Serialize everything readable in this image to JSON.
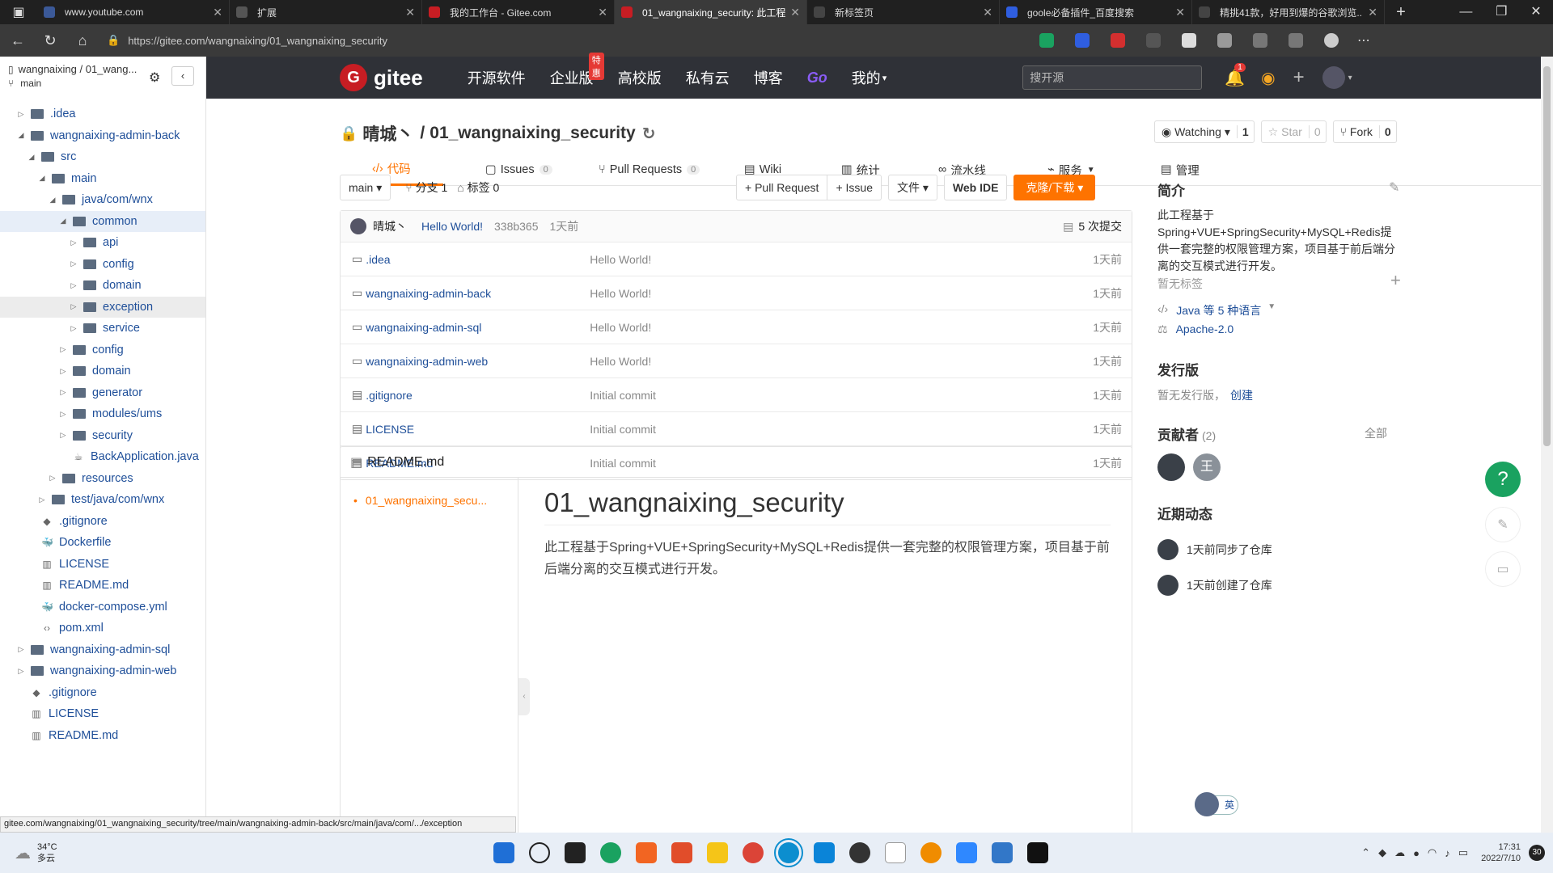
{
  "browser": {
    "tabs": [
      {
        "title": "www.youtube.com",
        "color": "#3b5998"
      },
      {
        "title": "扩展",
        "color": "#555"
      },
      {
        "title": "我的工作台 - Gitee.com",
        "color": "#c71d23"
      },
      {
        "title": "01_wangnaixing_security: 此工程...",
        "color": "#c71d23"
      },
      {
        "title": "新标签页",
        "color": "#444"
      },
      {
        "title": "goole必备插件_百度搜索",
        "color": "#2f5ee0"
      },
      {
        "title": "精挑41款，好用到爆的谷歌浏览...",
        "color": "#444"
      }
    ],
    "url": "https://gitee.com/wangnaixing/01_wangnaixing_security"
  },
  "sidebar": {
    "repo": "wangnaixing / 01_wang...",
    "branch": "main",
    "items": [
      {
        "label": ".idea",
        "type": "folder",
        "depth": 1,
        "open": false
      },
      {
        "label": "wangnaixing-admin-back",
        "type": "folder",
        "depth": 1,
        "open": true
      },
      {
        "label": "src",
        "type": "folder",
        "depth": 2,
        "open": true
      },
      {
        "label": "main",
        "type": "folder",
        "depth": 3,
        "open": true
      },
      {
        "label": "java/com/wnx",
        "type": "folder",
        "depth": 4,
        "open": true
      },
      {
        "label": "common",
        "type": "folder",
        "depth": 5,
        "open": true,
        "sel": true
      },
      {
        "label": "api",
        "type": "folder",
        "depth": 6,
        "open": false
      },
      {
        "label": "config",
        "type": "folder",
        "depth": 6,
        "open": false
      },
      {
        "label": "domain",
        "type": "folder",
        "depth": 6,
        "open": false
      },
      {
        "label": "exception",
        "type": "folder",
        "depth": 6,
        "open": false,
        "hov": true
      },
      {
        "label": "service",
        "type": "folder",
        "depth": 6,
        "open": false
      },
      {
        "label": "config",
        "type": "folder",
        "depth": 5,
        "open": false
      },
      {
        "label": "domain",
        "type": "folder",
        "depth": 5,
        "open": false
      },
      {
        "label": "generator",
        "type": "folder",
        "depth": 5,
        "open": false
      },
      {
        "label": "modules/ums",
        "type": "folder",
        "depth": 5,
        "open": false
      },
      {
        "label": "security",
        "type": "folder",
        "depth": 5,
        "open": false
      },
      {
        "label": "BackApplication.java",
        "type": "java",
        "depth": 5
      },
      {
        "label": "resources",
        "type": "folder",
        "depth": 4,
        "open": false
      },
      {
        "label": "test/java/com/wnx",
        "type": "folder",
        "depth": 3,
        "open": false
      },
      {
        "label": ".gitignore",
        "type": "git",
        "depth": 2
      },
      {
        "label": "Dockerfile",
        "type": "docker",
        "depth": 2
      },
      {
        "label": "LICENSE",
        "type": "book",
        "depth": 2
      },
      {
        "label": "README.md",
        "type": "book",
        "depth": 2
      },
      {
        "label": "docker-compose.yml",
        "type": "docker",
        "depth": 2
      },
      {
        "label": "pom.xml",
        "type": "code",
        "depth": 2
      },
      {
        "label": "wangnaixing-admin-sql",
        "type": "folder",
        "depth": 1,
        "open": false
      },
      {
        "label": "wangnaixing-admin-web",
        "type": "folder",
        "depth": 1,
        "open": false
      },
      {
        "label": ".gitignore",
        "type": "git",
        "depth": 1
      },
      {
        "label": "LICENSE",
        "type": "book",
        "depth": 1
      },
      {
        "label": "README.md",
        "type": "book",
        "depth": 1
      }
    ]
  },
  "header": {
    "logo": "gitee",
    "nav": [
      "开源软件",
      "企业版",
      "高校版",
      "私有云",
      "博客",
      "Go",
      "我的"
    ],
    "badge": "特惠",
    "search_placeholder": "搜开源",
    "notify_count": "1"
  },
  "repo": {
    "owner": "晴城丶",
    "name": "01_wangnaixing_security",
    "watch_label": "Watching",
    "watch_count": "1",
    "star_label": "Star",
    "star_count": "0",
    "fork_label": "Fork",
    "fork_count": "0",
    "tabs": [
      {
        "label": "代码",
        "active": true
      },
      {
        "label": "Issues",
        "count": "0"
      },
      {
        "label": "Pull Requests",
        "count": "0"
      },
      {
        "label": "Wiki"
      },
      {
        "label": "统计"
      },
      {
        "label": "流水线"
      },
      {
        "label": "服务"
      },
      {
        "label": "管理"
      }
    ],
    "branch": "main",
    "branches": "分支 1",
    "tags": "标签 0",
    "btn_pr": "+ Pull Request",
    "btn_issue": "+ Issue",
    "btn_file": "文件",
    "btn_webide": "Web IDE",
    "btn_clone": "克隆/下载",
    "commit": {
      "author": "晴城丶",
      "msg": "Hello World!",
      "hash": "338b365",
      "time": "1天前",
      "count": "5 次提交"
    },
    "files": [
      {
        "name": ".idea",
        "type": "folder",
        "msg": "Hello World!",
        "time": "1天前"
      },
      {
        "name": "wangnaixing-admin-back",
        "type": "folder",
        "msg": "Hello World!",
        "time": "1天前"
      },
      {
        "name": "wangnaixing-admin-sql",
        "type": "folder",
        "msg": "Hello World!",
        "time": "1天前"
      },
      {
        "name": "wangnaixing-admin-web",
        "type": "folder",
        "msg": "Hello World!",
        "time": "1天前"
      },
      {
        "name": ".gitignore",
        "type": "file",
        "msg": "Initial commit",
        "time": "1天前"
      },
      {
        "name": "LICENSE",
        "type": "file",
        "msg": "Initial commit",
        "time": "1天前"
      },
      {
        "name": "README.md",
        "type": "file",
        "msg": "Initial commit",
        "time": "1天前"
      }
    ],
    "readme": {
      "title": "README.md",
      "toc": "01_wangnaixing_secu...",
      "h1": "01_wangnaixing_security",
      "body": "此工程基于Spring+VUE+SpringSecurity+MySQL+Redis提供一套完整的权限管理方案，项目基于前后端分离的交互模式进行开发。"
    }
  },
  "aside": {
    "intro_title": "简介",
    "intro": "此工程基于Spring+VUE+SpringSecurity+MySQL+Redis提供一套完整的权限管理方案，项目基于前后端分离的交互模式进行开发。",
    "no_tags": "暂无标签",
    "lang": "Java 等 5 种语言",
    "license": "Apache-2.0",
    "release_title": "发行版",
    "no_release": "暂无发行版，",
    "create": "创建",
    "contrib_title": "贡献者",
    "contrib_count": "(2)",
    "all": "全部",
    "contrib_initial": "王",
    "activity_title": "近期动态",
    "activities": [
      "1天前同步了仓库",
      "1天前创建了仓库"
    ]
  },
  "statusbar": "gitee.com/wangnaixing/01_wangnaixing_security/tree/main/wangnaixing-admin-back/src/main/java/com/.../exception",
  "taskbar": {
    "temp": "34°C",
    "weather": "多云",
    "time": "17:31",
    "date": "2022/7/10",
    "notif": "30",
    "ime": "英"
  }
}
